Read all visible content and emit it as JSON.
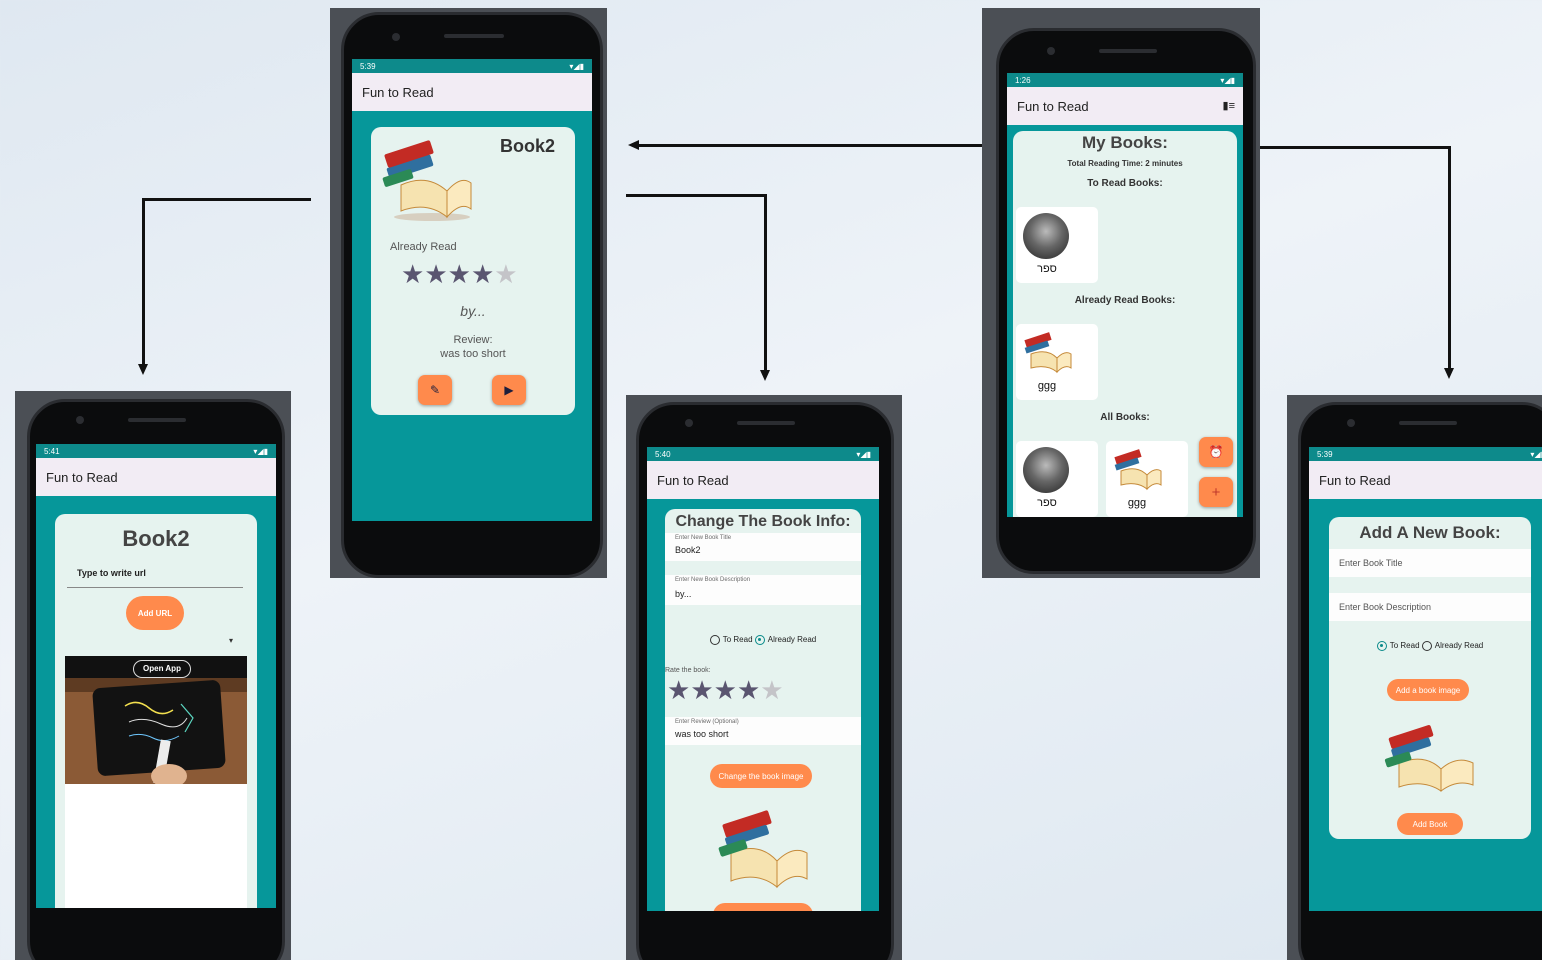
{
  "colors": {
    "teal": "#06979a",
    "status_teal": "#0d8a8b",
    "appbar": "#f2ecf4",
    "card": "#e6f3ef",
    "accent_orange": "#ff8a4c",
    "star_on": "#5a5570",
    "star_off": "#c4c4c8"
  },
  "app_title": "Fun to Read",
  "screen_details": {
    "time": "5:39",
    "book_title": "Book2",
    "status": "Already Read",
    "rating": 4,
    "rating_max": 5,
    "description": "by...",
    "review_label": "Review:",
    "review_text": "was too short",
    "edit_icon": "pencil-icon",
    "play_icon": "play-icon"
  },
  "screen_url": {
    "time": "5:41",
    "book_title": "Book2",
    "url_placeholder": "Type to write url",
    "add_url_button": "Add URL",
    "dropdown_icon": "caret-down-icon",
    "open_app_button": "Open App"
  },
  "screen_edit": {
    "time": "5:40",
    "heading": "Change The Book Info:",
    "title_label": "Enter New Book Title",
    "title_value": "Book2",
    "desc_label": "Enter New Book Description",
    "desc_value": "by...",
    "radio_to_read": "To Read",
    "radio_already_read": "Already Read",
    "selected": "Already Read",
    "rate_label": "Rate the book:",
    "rating": 4,
    "review_label": "Enter Review (Optional)",
    "review_value": "was too short",
    "change_image_button": "Change the book image"
  },
  "screen_home": {
    "time": "1:26",
    "heading": "My Books:",
    "total_time": "Total Reading Time: 2 minutes",
    "to_read_heading": "To Read Books:",
    "to_read_books": [
      {
        "title": "ספר"
      }
    ],
    "already_read_heading": "Already Read Books:",
    "already_read_books": [
      {
        "title": "ggg"
      }
    ],
    "all_heading": "All Books:",
    "all_books": [
      {
        "title": "ספר"
      },
      {
        "title": "ggg"
      }
    ],
    "alarm_icon": "alarm-icon",
    "add_icon": "plus-icon",
    "toolbar_icon": "book-icon"
  },
  "screen_add": {
    "time": "5:39",
    "heading": "Add A New Book:",
    "title_placeholder": "Enter Book Title",
    "desc_placeholder": "Enter Book Description",
    "radio_to_read": "To Read",
    "radio_already_read": "Already Read",
    "selected": "To Read",
    "add_image_button": "Add a book image",
    "add_book_button": "Add Book"
  }
}
